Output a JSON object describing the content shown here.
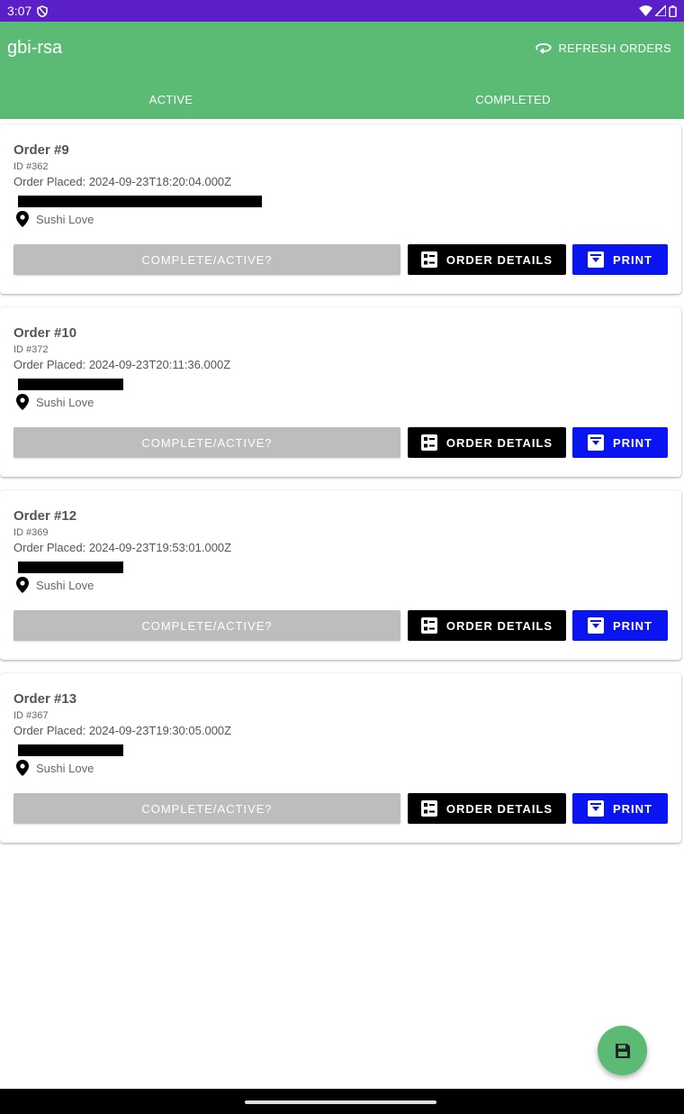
{
  "status_bar": {
    "time": "3:07"
  },
  "app": {
    "title": "gbi-rsa",
    "refresh_label": "REFRESH ORDERS",
    "brand_color": "#5bbb74"
  },
  "tabs": [
    {
      "label": "ACTIVE",
      "active": true
    },
    {
      "label": "COMPLETED",
      "active": false
    }
  ],
  "buttons": {
    "complete_label": "COMPLETE/ACTIVE?",
    "details_label": "ORDER DETAILS",
    "print_label": "PRINT"
  },
  "orders": [
    {
      "title": "Order #9",
      "id": "ID #362",
      "placed": "Order Placed: 2024-09-23T18:20:04.000Z",
      "location": "Sushi Love"
    },
    {
      "title": "Order #10",
      "id": "ID #372",
      "placed": "Order Placed: 2024-09-23T20:11:36.000Z",
      "location": "Sushi Love"
    },
    {
      "title": "Order #12",
      "id": "ID #369",
      "placed": "Order Placed: 2024-09-23T19:53:01.000Z",
      "location": "Sushi Love"
    },
    {
      "title": "Order #13",
      "id": "ID #367",
      "placed": "Order Placed: 2024-09-23T19:30:05.000Z",
      "location": "Sushi Love"
    }
  ],
  "icons": {
    "status_left": [
      "shield-icon"
    ],
    "status_right": [
      "wifi-icon",
      "signal-icon",
      "battery-icon"
    ],
    "refresh": "refresh-icon",
    "location": "location-pin-icon",
    "details": "list-details-icon",
    "print": "print-icon",
    "fab": "save-icon"
  },
  "colors": {
    "status_bar": "#5a1fc9",
    "details_button": "#000000",
    "print_button": "#0a14f0",
    "complete_button": "#bdbdbd"
  }
}
